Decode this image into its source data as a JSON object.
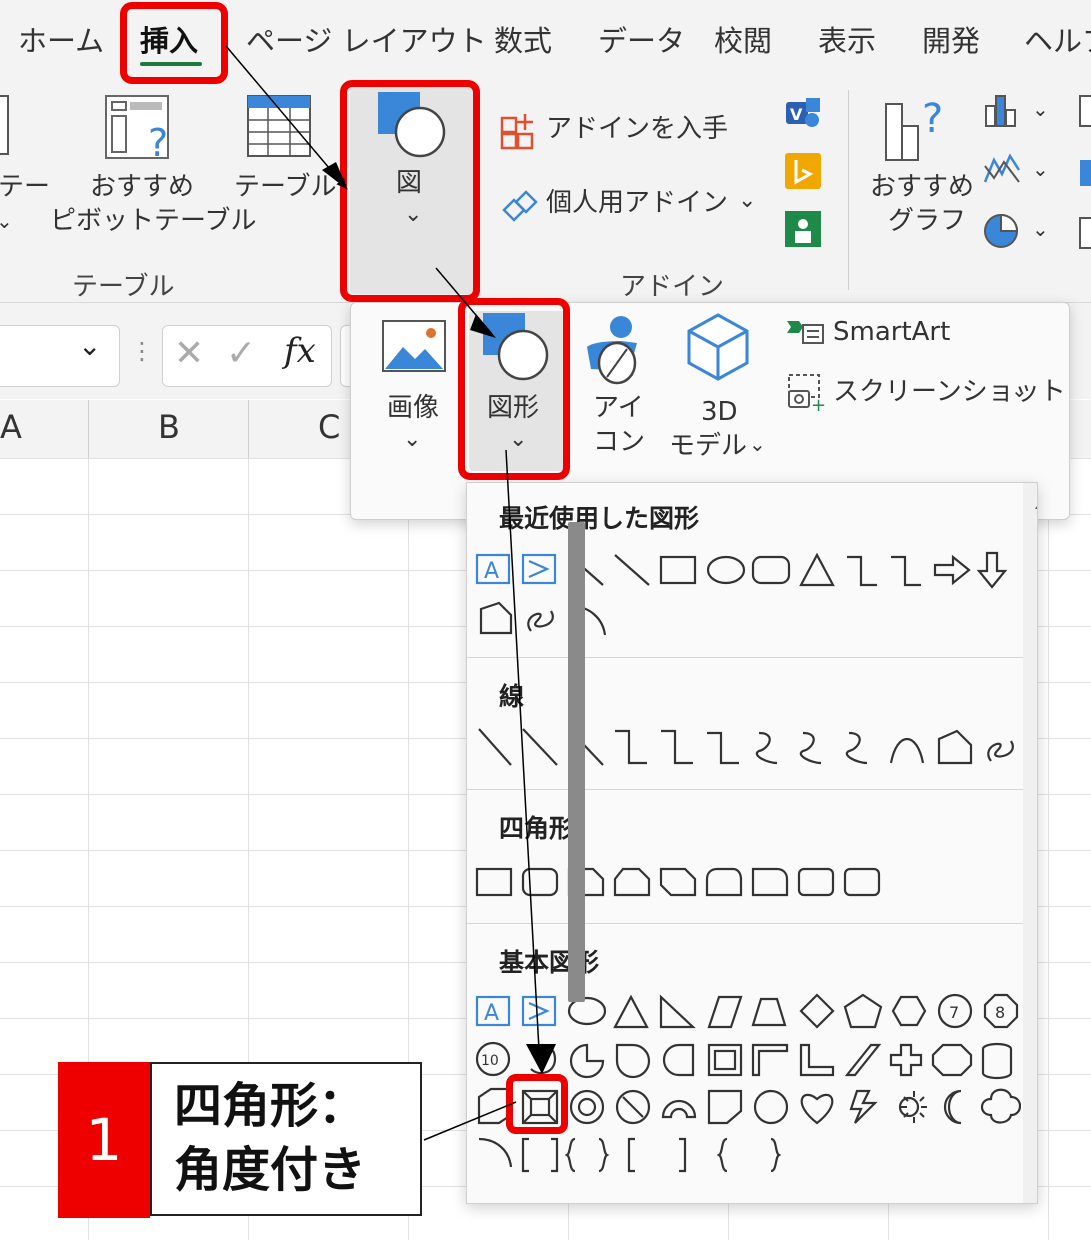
{
  "ribbon_tabs": [
    {
      "label": "ホーム"
    },
    {
      "label": "挿入",
      "active": true
    },
    {
      "label": "ページ レイアウト"
    },
    {
      "label": "数式"
    },
    {
      "label": "データ"
    },
    {
      "label": "校閲"
    },
    {
      "label": "表示"
    },
    {
      "label": "開発"
    },
    {
      "label": "ヘルプ"
    }
  ],
  "tables_group": {
    "pivot_partial_top": "テー",
    "recommended_pivot_line1": "おすすめ",
    "recommended_pivot_line2": "ピボットテーブル",
    "table_label": "テーブル",
    "group_label": "テーブル"
  },
  "illustrations": {
    "label": "図"
  },
  "addins_group": {
    "get_addins": "アドインを入手",
    "my_addins": "個人用アドイン",
    "group_label": "アドイン"
  },
  "charts_group": {
    "recommended_line1": "おすすめ",
    "recommended_line2": "グラフ"
  },
  "formula_bar": {
    "fx": "fx"
  },
  "columns": [
    "A",
    "B",
    "C"
  ],
  "illustrations_menu": {
    "image": "画像",
    "shapes": "図形",
    "icons_line1": "アイ",
    "icons_line2": "コン",
    "model3d_line1": "3D",
    "model3d_line2": "モデル",
    "smartart": "SmartArt",
    "screenshot": "スクリーンショット"
  },
  "shapes_gallery": {
    "categories": [
      "最近使用した図形",
      "線",
      "四角形",
      "基本図形"
    ],
    "octagon_number": "8",
    "decagon_number": "10",
    "heptagon_number": "7"
  },
  "callout": {
    "number": "1",
    "line1": "四角形：",
    "line2": "角度付き"
  },
  "colors": {
    "highlight": "#ee0000",
    "active_tab_underline": "#1c7a3e",
    "icon_blue": "#3a86d8"
  }
}
